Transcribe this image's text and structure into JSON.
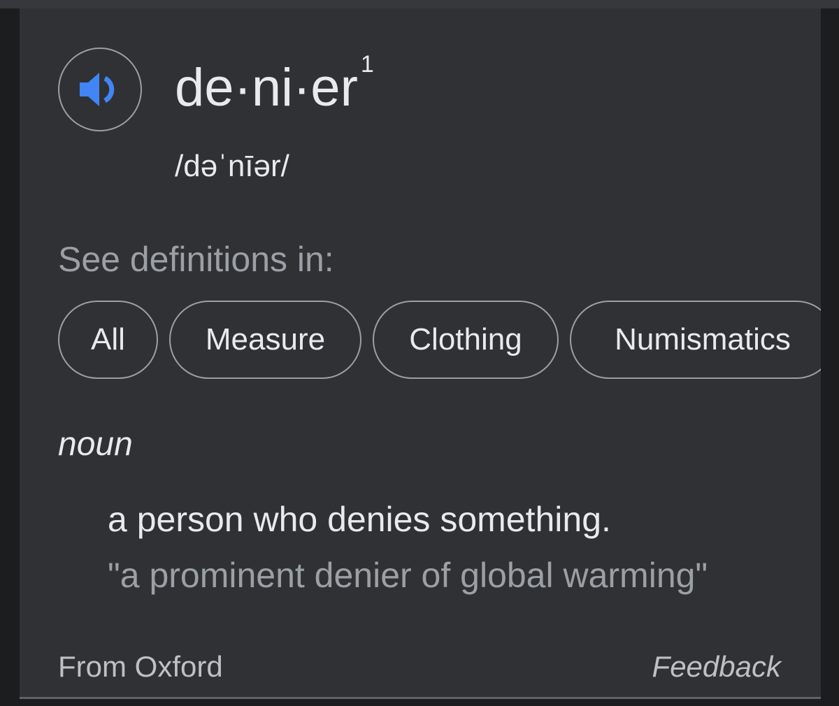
{
  "entry": {
    "headword": "de·ni·er",
    "superscript": "1",
    "phonetic": "/dəˈnīər/",
    "speaker_icon": "speaker-icon",
    "accent_color": "#4285f4"
  },
  "see_definitions": {
    "label": "See definitions in:",
    "chips": [
      {
        "label": "All"
      },
      {
        "label": "Measure"
      },
      {
        "label": "Clothing"
      },
      {
        "label": "Numismatics"
      }
    ]
  },
  "sense": {
    "part_of_speech": "noun",
    "definition": "a person who denies something.",
    "example": "\"a prominent denier of global warming\""
  },
  "footer": {
    "source": "From Oxford",
    "feedback": "Feedback"
  }
}
